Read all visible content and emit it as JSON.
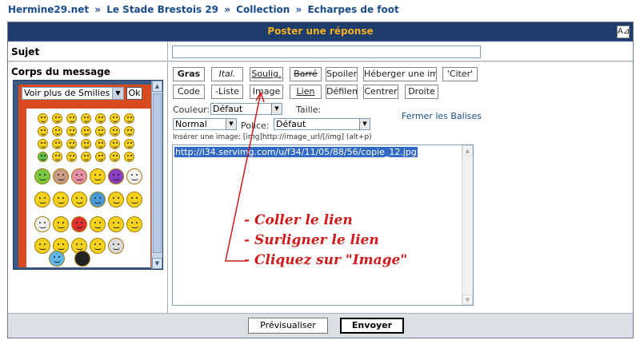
{
  "breadcrumb": {
    "items": [
      "Hermine29.net",
      "Le Stade Brestois 29",
      "Collection",
      "Echarpes de foot"
    ],
    "separator": "»"
  },
  "panel": {
    "title": "Poster une réponse",
    "resize_glyph": "A⊿"
  },
  "subject": {
    "label": "Sujet",
    "value": ""
  },
  "body": {
    "label": "Corps du message"
  },
  "smilies": {
    "select_value": "Voir plus de Smilies",
    "ok_label": "Ok"
  },
  "toolbar": {
    "row1": [
      "Gras",
      "Ital.",
      "Soulig.",
      "Barré",
      "Spoiler",
      "Héberger une im",
      "'Citer'"
    ],
    "row2": [
      "Code",
      "-Liste",
      "Image",
      "Lien",
      "Défilem",
      "Centrer",
      "Droite"
    ]
  },
  "formatting": {
    "couleur_label": "Couleur:",
    "couleur_value": "Défaut",
    "taille_label": "Taille:",
    "taille_value": "Normal",
    "police_label": "Police:",
    "police_value": "Défaut",
    "close_tags_link": "Fermer les Balises",
    "hint": "Insérer une image: [img]http://image_url/[/img] (alt+p)"
  },
  "textarea": {
    "value": "http://i34.servimg.com/u/f34/11/05/88/56/copie_12.jpg"
  },
  "annotations": [
    "- Coller le lien",
    "- Surligner le lien",
    "- Cliquez sur \"Image\""
  ],
  "buttons": {
    "preview": "Prévisualiser",
    "send": "Envoyer"
  },
  "colors": {
    "header_bg": "#1f3c6c",
    "title_text": "#f0b020",
    "annotation": "#d11a1a",
    "link": "#1a4c8c"
  }
}
